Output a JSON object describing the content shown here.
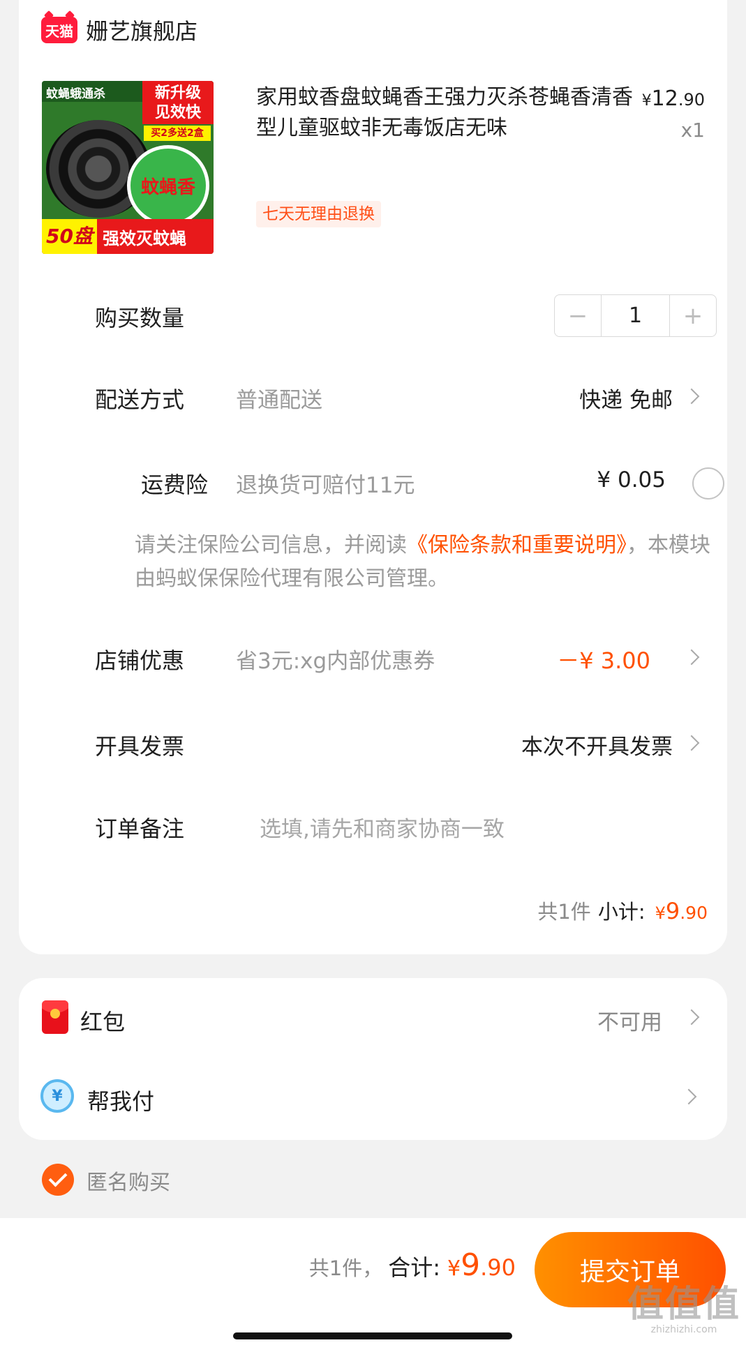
{
  "shop": {
    "badge": "天猫",
    "name": "姗艺旗舰店"
  },
  "product": {
    "image_texts": {
      "top": "蚊蝇蛾通杀",
      "badge_line1": "新升级",
      "badge_line2": "见效快",
      "promo": "买2多送2盒",
      "label": "蚊蝇香",
      "count": "50盘",
      "slogan": "强效灭蚊蝇"
    },
    "title": "家用蚊香盘蚊蝇香王强力灭杀苍蝇香清香型儿童驱蚊非无毒饭店无味",
    "price_yen": "¥",
    "price_int": "12",
    "price_dec": ".90",
    "quantity": "x1",
    "tag": "七天无理由退换"
  },
  "quantity_row": {
    "label": "购买数量",
    "minus": "−",
    "value": "1",
    "plus": "+"
  },
  "delivery": {
    "label": "配送方式",
    "method": "普通配送",
    "detail": "快递 免邮"
  },
  "insurance": {
    "label": "运费险",
    "desc": "退换货可赔付11元",
    "price": "¥ 0.05",
    "notice_before": "请关注保险公司信息，并阅读",
    "notice_link": "《保险条款和重要说明》",
    "notice_after": "，本模块由蚂蚁保保险代理有限公司管理。"
  },
  "shop_discount": {
    "label": "店铺优惠",
    "desc": "省3元:xg内部优惠券",
    "amount": "－¥ 3.00"
  },
  "invoice": {
    "label": "开具发票",
    "value": "本次不开具发票"
  },
  "remark": {
    "label": "订单备注",
    "placeholder": "选填,请先和商家协商一致"
  },
  "subtotal": {
    "count": "共1件",
    "label": "小计:",
    "yen": "¥",
    "int": "9",
    "dec": ".90"
  },
  "red_packet": {
    "label": "红包",
    "status": "不可用"
  },
  "pay_for_me": {
    "label": "帮我付",
    "icon_text": "¥"
  },
  "anonymous": {
    "label": "匿名购买"
  },
  "footer": {
    "count": "共1件，",
    "label": "合计:",
    "yen": "¥",
    "int": "9",
    "dec": ".90",
    "submit": "提交订单"
  },
  "watermark": {
    "big": "值值值",
    "small": "zhizhizhi.com"
  },
  "colors": {
    "accent": "#ff5000",
    "accent_start": "#ff9000",
    "tmall_red": "#ff1c3c"
  }
}
